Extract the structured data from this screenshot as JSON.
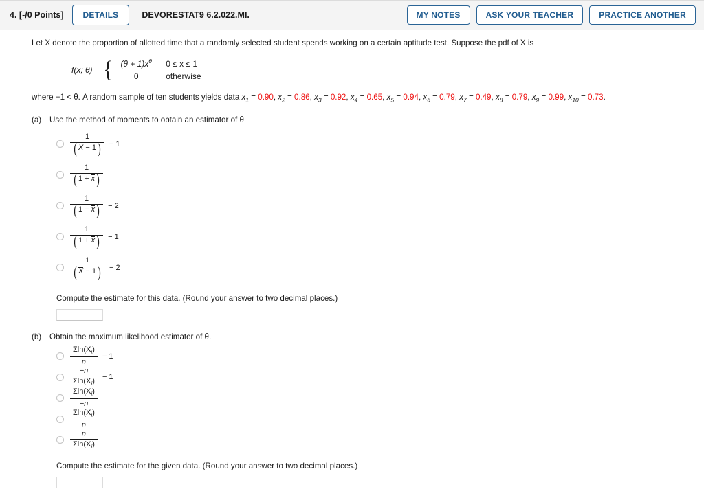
{
  "header": {
    "question_number": "4.",
    "points": "[-/0 Points]",
    "details_label": "DETAILS",
    "assignment_title": "DEVORESTAT9 6.2.022.MI.",
    "my_notes_label": "MY NOTES",
    "ask_teacher_label": "ASK YOUR TEACHER",
    "practice_another_label": "PRACTICE ANOTHER",
    "accent_color": "#2a6496",
    "background_color": "#f4f4f4"
  },
  "problem": {
    "intro": "Let X denote the proportion of allotted time that a randomly selected student spends working on a certain aptitude test. Suppose the pdf of X is",
    "pdf": {
      "lhs": "f(x; θ) =",
      "case1_expr": "(θ + 1)x",
      "case1_exponent": "θ",
      "case1_condition": "0 ≤ x ≤ 1",
      "case2_expr": "0",
      "case2_condition": "otherwise"
    },
    "where_prefix": "where −1 < θ. A random sample of ten students yields data ",
    "data_values": [
      "0.90",
      "0.86",
      "0.92",
      "0.65",
      "0.94",
      "0.79",
      "0.49",
      "0.79",
      "0.99",
      "0.73"
    ],
    "data_color": "#ee1111",
    "data_suffix": "."
  },
  "parts": [
    {
      "label": "(a)",
      "prompt": "Use the method of moments to obtain an estimator of θ",
      "options": [
        {
          "numerator": "1",
          "denominator": "X − 1",
          "denominator_overline": "X",
          "tail": "− 1"
        },
        {
          "numerator": "1",
          "denominator": "1 + x",
          "denominator_overline": "x",
          "tail": ""
        },
        {
          "numerator": "1",
          "denominator": "1 − x",
          "denominator_overline": "x",
          "tail": "− 2"
        },
        {
          "numerator": "1",
          "denominator": "1 + x",
          "denominator_overline": "x",
          "tail": "− 1"
        },
        {
          "numerator": "1",
          "denominator": "X − 1",
          "denominator_overline": "X",
          "tail": "− 2"
        }
      ],
      "compute_text": "Compute the estimate for this data. (Round your answer to two decimal places.)",
      "answer_value": "",
      "answer_placeholder": ""
    },
    {
      "label": "(b)",
      "prompt": "Obtain the maximum likelihood estimator of θ.",
      "options": [
        {
          "numerator": "Σln(X",
          "num_sub": "i",
          "num_tail": ")",
          "denominator": "n",
          "tail": "− 1"
        },
        {
          "numerator": "−n",
          "denominator": "Σln(X",
          "den_sub": "i",
          "den_tail": ")",
          "tail": "− 1"
        },
        {
          "numerator": "Σln(X",
          "num_sub": "i",
          "num_tail": ")",
          "denominator": "−n",
          "tail": ""
        },
        {
          "numerator": "Σln(X",
          "num_sub": "i",
          "num_tail": ")",
          "denominator": "n",
          "tail": ""
        },
        {
          "numerator": "n",
          "denominator": "Σln(X",
          "den_sub": "i",
          "den_tail": ")",
          "tail": ""
        }
      ],
      "compute_text": "Compute the estimate for the given data. (Round your answer to two decimal places.)",
      "answer_value": "",
      "answer_placeholder": ""
    }
  ]
}
